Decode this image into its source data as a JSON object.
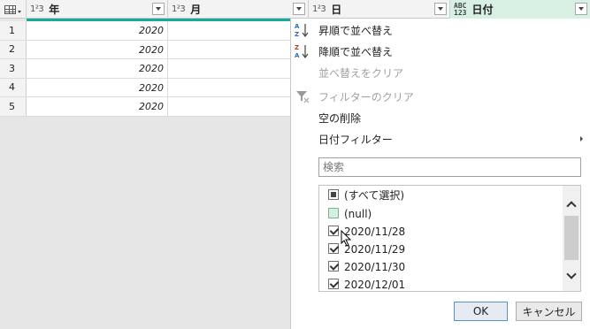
{
  "columns": [
    {
      "type_label": "1²3",
      "name": "年"
    },
    {
      "type_label": "1²3",
      "name": "月"
    },
    {
      "type_label": "1²3",
      "name": "日"
    },
    {
      "type_label_top": "ABC",
      "type_label_bottom": "123",
      "name": "日付"
    }
  ],
  "rows": [
    {
      "num": "1",
      "year": "2020"
    },
    {
      "num": "2",
      "year": "2020"
    },
    {
      "num": "3",
      "year": "2020"
    },
    {
      "num": "4",
      "year": "2020"
    },
    {
      "num": "5",
      "year": "2020"
    }
  ],
  "menu": {
    "sort_asc": "昇順で並べ替え",
    "sort_desc": "降順で並べ替え",
    "clear_sort": "並べ替えをクリア",
    "clear_filter": "フィルターのクリア",
    "remove_empty": "空の削除",
    "date_filters": "日付フィルター",
    "search_placeholder": "検索",
    "filter_items": [
      {
        "label": "(すべて選択)",
        "state": "indeterminate"
      },
      {
        "label": "(null)",
        "state": "unchecked"
      },
      {
        "label": "2020/11/28",
        "state": "checked"
      },
      {
        "label": "2020/11/29",
        "state": "checked"
      },
      {
        "label": "2020/11/30",
        "state": "checked"
      },
      {
        "label": "2020/12/01",
        "state": "checked"
      }
    ],
    "ok": "OK",
    "cancel": "キャンセル"
  },
  "icons": {
    "sort_asc": "sort-ascending-icon",
    "sort_desc": "sort-descending-icon",
    "clear_filter": "clear-filter-icon"
  },
  "colors": {
    "accent": "#13aaa0",
    "active_header": "#d7f0e3"
  }
}
